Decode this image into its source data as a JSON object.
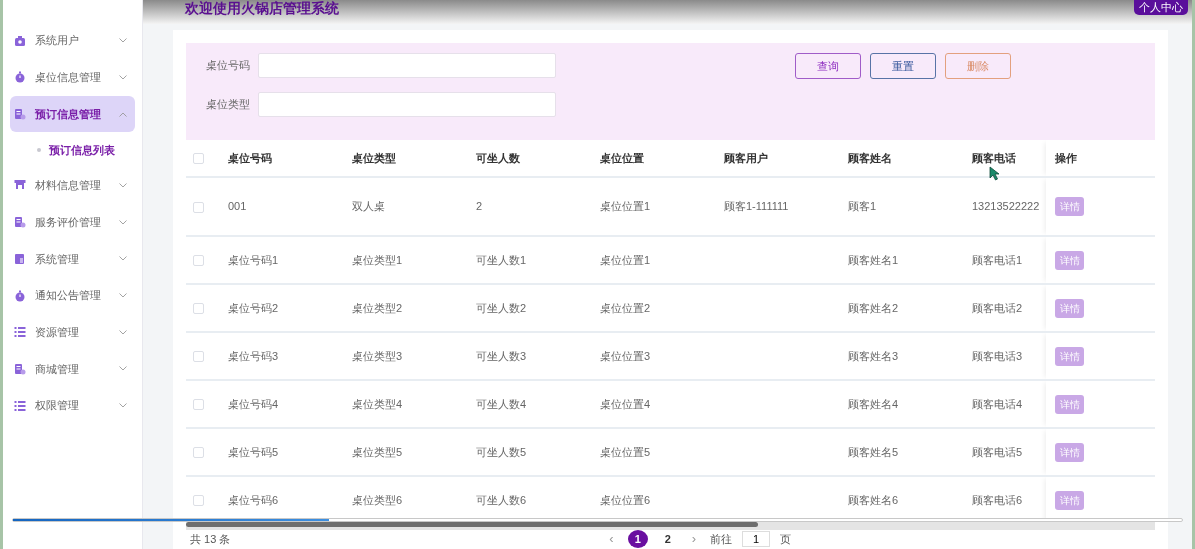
{
  "header": {
    "title": "欢迎使用火锅店管理系统",
    "user_button": "个人中心"
  },
  "sidebar": {
    "items": [
      {
        "label": "系统用户",
        "kind": "badge",
        "selected": false,
        "expanded": false
      },
      {
        "label": "桌位信息管理",
        "kind": "timer",
        "selected": false,
        "expanded": false
      },
      {
        "label": "预订信息管理",
        "kind": "doc",
        "selected": true,
        "expanded": true,
        "children": [
          {
            "label": "预订信息列表",
            "selected": true
          }
        ]
      },
      {
        "label": "材料信息管理",
        "kind": "store",
        "selected": false,
        "expanded": false
      },
      {
        "label": "服务评价管理",
        "kind": "doc",
        "selected": false,
        "expanded": false
      },
      {
        "label": "系统管理",
        "kind": "page",
        "selected": false,
        "expanded": false
      },
      {
        "label": "通知公告管理",
        "kind": "timer",
        "selected": false,
        "expanded": false
      },
      {
        "label": "资源管理",
        "kind": "list",
        "selected": false,
        "expanded": false
      },
      {
        "label": "商城管理",
        "kind": "doc",
        "selected": false,
        "expanded": false
      },
      {
        "label": "权限管理",
        "kind": "list",
        "selected": false,
        "expanded": false
      }
    ]
  },
  "search": {
    "fields": [
      {
        "label": "桌位号码"
      },
      {
        "label": "桌位类型"
      }
    ],
    "buttons": [
      {
        "label": "查询",
        "kind": "query"
      },
      {
        "label": "重置",
        "kind": "reset"
      },
      {
        "label": "删除",
        "kind": "delete"
      }
    ]
  },
  "table": {
    "all_checked": false,
    "columns": [
      "桌位号码",
      "桌位类型",
      "可坐人数",
      "桌位位置",
      "顾客用户",
      "顾客姓名",
      "顾客电话",
      "操作"
    ],
    "rows": [
      {
        "checked": false,
        "cells": [
          "001",
          "双人桌",
          "2",
          "桌位位置1",
          "顾客1-111111",
          "顾客1",
          "13213522222"
        ],
        "action": "详情"
      },
      {
        "checked": false,
        "cells": [
          "桌位号码1",
          "桌位类型1",
          "可坐人数1",
          "桌位位置1",
          "",
          "顾客姓名1",
          "顾客电话1"
        ],
        "action": "详情"
      },
      {
        "checked": false,
        "cells": [
          "桌位号码2",
          "桌位类型2",
          "可坐人数2",
          "桌位位置2",
          "",
          "顾客姓名2",
          "顾客电话2"
        ],
        "action": "详情"
      },
      {
        "checked": false,
        "cells": [
          "桌位号码3",
          "桌位类型3",
          "可坐人数3",
          "桌位位置3",
          "",
          "顾客姓名3",
          "顾客电话3"
        ],
        "action": "详情"
      },
      {
        "checked": false,
        "cells": [
          "桌位号码4",
          "桌位类型4",
          "可坐人数4",
          "桌位位置4",
          "",
          "顾客姓名4",
          "顾客电话4"
        ],
        "action": "详情"
      },
      {
        "checked": false,
        "cells": [
          "桌位号码5",
          "桌位类型5",
          "可坐人数5",
          "桌位位置5",
          "",
          "顾客姓名5",
          "顾客电话5"
        ],
        "action": "详情"
      },
      {
        "checked": false,
        "cells": [
          "桌位号码6",
          "桌位类型6",
          "可坐人数6",
          "桌位位置6",
          "",
          "顾客姓名6",
          "顾客电话6"
        ],
        "action": "详情"
      }
    ]
  },
  "pagination": {
    "total": "共 13 条",
    "prev": "‹",
    "pages": [
      {
        "label": "1",
        "selected": true
      },
      {
        "label": "2",
        "selected": false
      }
    ],
    "next": "›",
    "goto_label": "前往",
    "goto_value": "1",
    "goto_suffix": "页"
  },
  "loading_bar": {
    "level": 0.27
  }
}
